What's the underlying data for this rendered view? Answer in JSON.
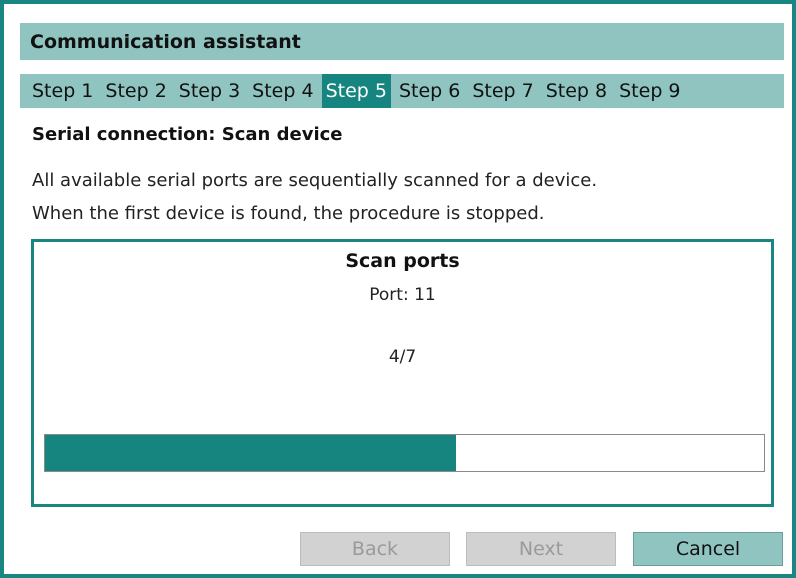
{
  "window": {
    "title": "Communication assistant"
  },
  "steps": [
    {
      "label": "Step 1",
      "active": false
    },
    {
      "label": "Step 2",
      "active": false
    },
    {
      "label": "Step 3",
      "active": false
    },
    {
      "label": "Step 4",
      "active": false
    },
    {
      "label": "Step 5",
      "active": true
    },
    {
      "label": "Step 6",
      "active": false
    },
    {
      "label": "Step 7",
      "active": false
    },
    {
      "label": "Step 8",
      "active": false
    },
    {
      "label": "Step 9",
      "active": false
    }
  ],
  "page": {
    "heading": "Serial connection: Scan device",
    "description_line1": "All available serial ports are sequentially scanned for a device.",
    "description_line2": "When the first device is found, the procedure is stopped."
  },
  "scan": {
    "title": "Scan ports",
    "port_text": "Port: 11",
    "count_text": "4/7",
    "progress_fraction": 0.571
  },
  "buttons": {
    "back_label": "Back",
    "next_label": "Next",
    "cancel_label": "Cancel",
    "back_enabled": false,
    "next_enabled": false,
    "cancel_enabled": true
  },
  "colors": {
    "accent": "#168580",
    "header_bg": "#8fc4c1",
    "disabled_button_bg": "#d2d2d2"
  }
}
